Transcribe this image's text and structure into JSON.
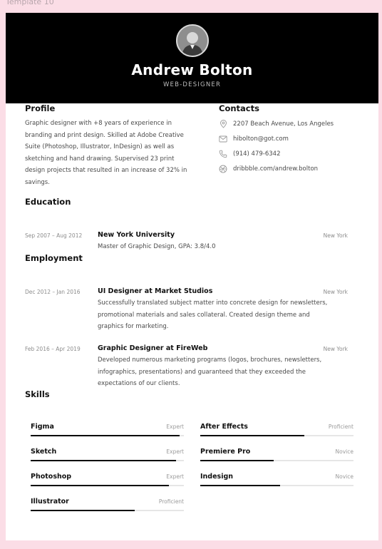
{
  "template_label": "Template 10",
  "header": {
    "name": "Andrew Bolton",
    "role": "WEB-DESIGNER"
  },
  "profile": {
    "title": "Profile",
    "lines": [
      "Graphic designer with +8 years of experience in",
      "branding and print design. Skilled at Adobe Creative",
      "Suite (Photoshop, Illustrator, InDesign) as well as",
      "sketching and hand drawing. Supervised 23 print",
      "design projects that resulted in an increase of 32% in",
      "savings."
    ]
  },
  "contacts": {
    "title": "Contacts",
    "items": [
      {
        "icon": "location-pin-icon",
        "text": "2207 Beach Avenue, Los Angeles"
      },
      {
        "icon": "mail-icon",
        "text": "hibolton@got.com"
      },
      {
        "icon": "phone-icon",
        "text": "(914) 479-6342"
      },
      {
        "icon": "dribbble-icon",
        "text": "dribbble.com/andrew.bolton"
      }
    ]
  },
  "education": {
    "title": "Education",
    "entries": [
      {
        "date": "Sep 2007 – Aug 2012",
        "head": "New York University",
        "location": "New York",
        "lines": [
          "Master of Graphic Design, GPA: 3.8/4.0"
        ]
      }
    ]
  },
  "employment": {
    "title": "Employment",
    "entries": [
      {
        "date": "Dec 2012 – Jan 2016",
        "head": "UI Designer at Market Studios",
        "location": "New York",
        "lines": [
          "Successfully translated subject matter into concrete design for newsletters,",
          "promotional materials and sales collateral. Created design theme and",
          "graphics for marketing."
        ]
      },
      {
        "date": "Feb 2016 – Apr 2019",
        "head": "Graphic Designer at FireWeb",
        "location": "New York",
        "lines": [
          "Developed numerous marketing programs (logos, brochures, newsletters,",
          "infographics, presentations) and guaranteed that they exceeded the",
          "expectations of our clients."
        ]
      }
    ]
  },
  "skills": {
    "title": "Skills",
    "items": [
      {
        "name": "Figma",
        "level": "Expert",
        "fill": 0.97
      },
      {
        "name": "After Effects",
        "level": "Proficient",
        "fill": 0.68
      },
      {
        "name": "Sketch",
        "level": "Expert",
        "fill": 0.95
      },
      {
        "name": "Premiere Pro",
        "level": "Novice",
        "fill": 0.48
      },
      {
        "name": "Photoshop",
        "level": "Expert",
        "fill": 0.9
      },
      {
        "name": "Indesign",
        "level": "Novice",
        "fill": 0.52
      },
      {
        "name": "Illustrator",
        "level": "Proficient",
        "fill": 0.68
      }
    ]
  },
  "colors": {
    "page_bg": "#fbdde6",
    "header_bg": "#000000",
    "bar_fill": "#000000",
    "bar_track": "#e6e6e6"
  }
}
